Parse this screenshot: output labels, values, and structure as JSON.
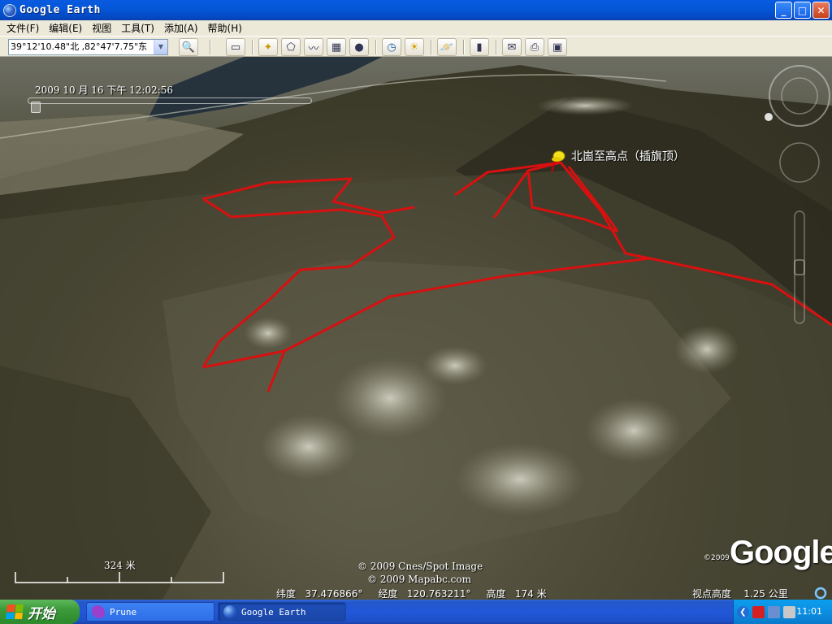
{
  "window": {
    "title": "Google Earth",
    "minimize": "_",
    "maximize": "□",
    "close": "✕"
  },
  "menu": [
    "文件(F)",
    "编辑(E)",
    "视图",
    "工具(T)",
    "添加(A)",
    "帮助(H)"
  ],
  "toolbar": {
    "search_value": "39°12'10.48\"北 ,82°47'7.75\"东",
    "buttons": [
      "search-icon",
      "sidebar-icon",
      "placemark-icon",
      "polygon-icon",
      "path-icon",
      "image-overlay-icon",
      "record-tour-icon",
      "history-icon",
      "sunlight-icon",
      "planet-icon",
      "ruler-icon",
      "email-icon",
      "print-icon",
      "save-image-icon"
    ]
  },
  "map": {
    "timestamp": "2009 10 月 16 下午  12:02:56",
    "placemark": "北崮至高点（插旗顶）",
    "copyright_1": "© 2009 Cnes/Spot Image",
    "copyright_2": "© 2009 Mapabc.com",
    "google_year": "©2009",
    "google_logo": "Google",
    "scale": "324 米"
  },
  "status": {
    "lat_label": "纬度",
    "lat_value": "37.476866°",
    "lon_label": "经度",
    "lon_value": "120.763211°",
    "elev_label": "高度",
    "elev_value": "174 米",
    "eye_label": "视点高度",
    "eye_value": "1.25 公里"
  },
  "taskbar": {
    "start": "开始",
    "tasks": [
      "Prune",
      "Google Earth"
    ],
    "clock": "11:01"
  },
  "colors": {
    "track": "#d81010",
    "title_bar": "#0458d8",
    "taskbar": "#2157d8",
    "start": "#3c9a3b"
  }
}
